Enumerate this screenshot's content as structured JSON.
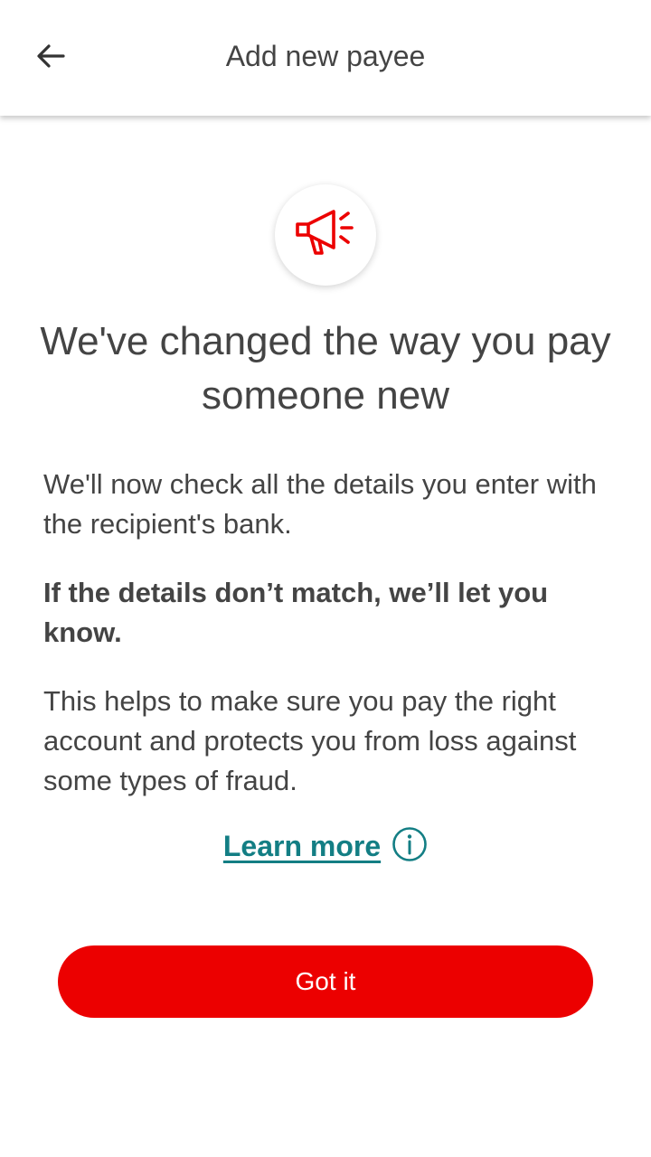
{
  "header": {
    "title": "Add new payee",
    "back_icon": "arrow-left-icon"
  },
  "notice": {
    "icon": "megaphone-icon",
    "icon_color": "#ec0000",
    "headline": "We've changed the way you pay someone new",
    "paragraph_1": "We'll now check all the details you enter with the recipient's bank.",
    "paragraph_2": "If the details don’t match, we’ll let you know.",
    "paragraph_3": "This helps to make sure you pay the right account and protects you from loss against some types of fraud."
  },
  "learn_more": {
    "label": "Learn more",
    "icon": "info-icon",
    "color": "#137e84"
  },
  "primary_action": {
    "label": "Got it",
    "color": "#ec0000"
  }
}
